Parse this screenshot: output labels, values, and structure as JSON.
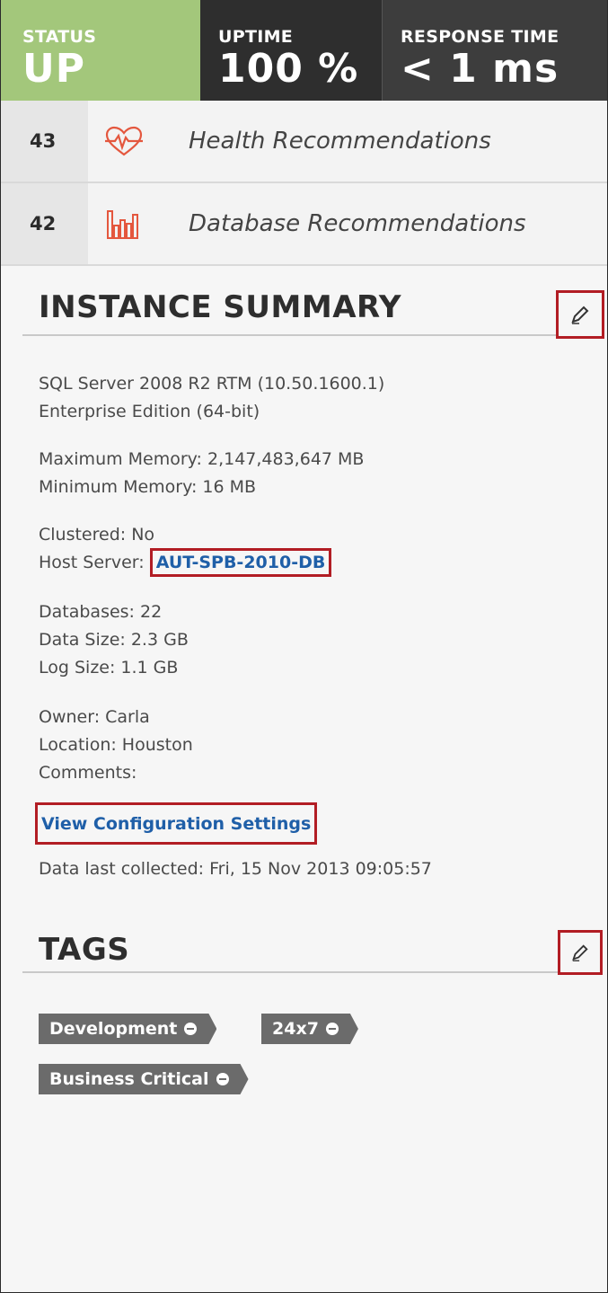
{
  "status_bar": {
    "status": {
      "label": "STATUS",
      "value": "UP"
    },
    "uptime": {
      "label": "UPTIME",
      "value": "100 %"
    },
    "response_time": {
      "label": "RESPONSE TIME",
      "value": "< 1 ms"
    }
  },
  "recommendations": [
    {
      "count": "43",
      "icon": "heart-pulse-icon",
      "label": "Health Recommendations"
    },
    {
      "count": "42",
      "icon": "bar-chart-icon",
      "label": "Database Recommendations"
    }
  ],
  "instance_summary": {
    "title": "INSTANCE SUMMARY",
    "version_line1": "SQL Server 2008 R2 RTM (10.50.1600.1)",
    "version_line2": "Enterprise Edition (64-bit)",
    "max_memory": "Maximum Memory: 2,147,483,647 MB",
    "min_memory": "Minimum Memory: 16 MB",
    "clustered": "Clustered: No",
    "host_server_label": "Host Server:",
    "host_server_value": "AUT-SPB-2010-DB",
    "databases": "Databases: 22",
    "data_size": "Data Size: 2.3 GB",
    "log_size": "Log Size: 1.1 GB",
    "owner": "Owner: Carla",
    "location": "Location: Houston",
    "comments": "Comments:",
    "view_config_link": "View Configuration Settings",
    "last_collected": "Data last collected: Fri, 15 Nov 2013 09:05:57"
  },
  "tags": {
    "title": "TAGS",
    "items": [
      "Development",
      "24x7",
      "Business Critical"
    ]
  },
  "colors": {
    "status_green": "#a3c77b",
    "dark_tile": "#2e2e2e",
    "accent_red": "#e4573e",
    "link_blue": "#1f5fa8",
    "highlight_box": "#b21d24",
    "tag_gray": "#6b6b6b"
  }
}
